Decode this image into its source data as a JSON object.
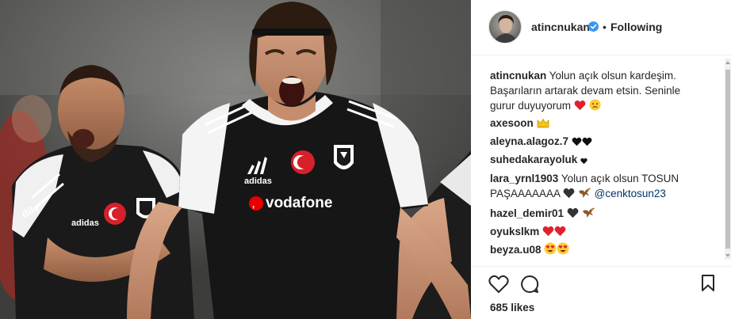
{
  "post": {
    "author": "atincnukan",
    "follow_state": "Following",
    "separator": "•",
    "likes_text": "685 likes"
  },
  "photo": {
    "jersey_sponsor": "vodafone"
  },
  "caption": {
    "username": "atincnukan",
    "text": "Yolun açık olsun kardeşim. Başarıların artarak devam etsin. Seninle gurur duyuyorum",
    "emojis": [
      "red-heart",
      "sad-face"
    ]
  },
  "comments": [
    {
      "username": "axesoon",
      "text": "",
      "emojis": [
        "crown"
      ]
    },
    {
      "username": "aleyna.alagoz.7",
      "text": "",
      "emojis": [
        "black-heart",
        "black-heart"
      ]
    },
    {
      "username": "suhedakarayoluk",
      "text": "",
      "emojis": [
        "small-black-heart"
      ]
    },
    {
      "username": "lara_yrnl1903",
      "text": "Yolun açık olsun TOSUN",
      "text2": "PAŞAAAAAAA",
      "emojis": [
        "black-heart",
        "eagle"
      ],
      "mention": "@cenktosun23"
    },
    {
      "username": "hazel_demir01",
      "text": "",
      "emojis": [
        "black-heart",
        "eagle"
      ]
    },
    {
      "username": "oyukslkm",
      "text": "",
      "emojis": [
        "red-heart",
        "red-heart"
      ]
    },
    {
      "username": "beyza.u08",
      "text": "",
      "emojis": [
        "heart-eyes",
        "heart-eyes"
      ]
    }
  ],
  "colors": {
    "verified": "#3897f0",
    "text": "#262626",
    "mention": "#003569",
    "heart": "#ed4956"
  }
}
